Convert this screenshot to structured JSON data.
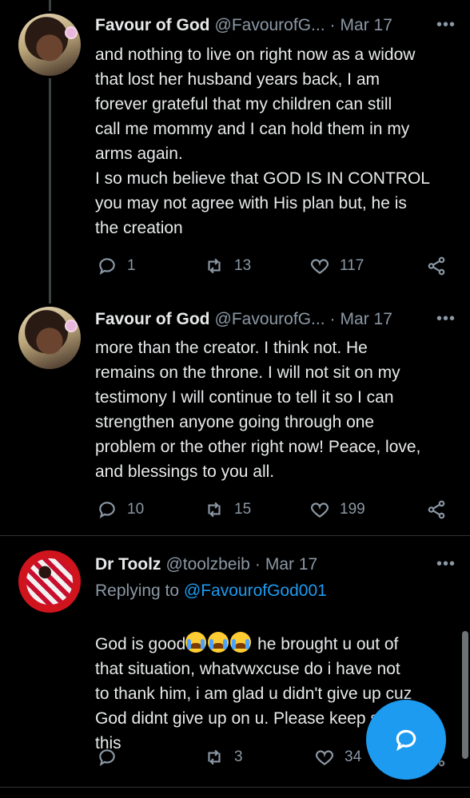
{
  "tweets": [
    {
      "name": "Favour of God",
      "handle": "@FavourofG...",
      "dot": "·",
      "date": "Mar 17",
      "more": "•••",
      "text": "and nothing to live on right now as a widow\nthat lost her husband years back, I am\nforever grateful that my children can still\ncall me mommy and I can hold them in my\narms again.\nI so much believe that GOD IS IN CONTROL\nyou may not agree with His plan but, he is\nthe creation",
      "replies": "1",
      "retweets": "13",
      "likes": "117"
    },
    {
      "name": "Favour of God",
      "handle": "@FavourofG...",
      "dot": "·",
      "date": "Mar 17",
      "more": "•••",
      "text": "more than the creator. I think not. He\nremains on the throne. I will not sit on my\ntestimony I will continue to tell it so I can\nstrengthen anyone going through one\nproblem or the other right now! Peace, love,\nand blessings to you all.",
      "replies": "10",
      "retweets": "15",
      "likes": "199"
    },
    {
      "name": "Dr Toolz",
      "handle": "@toolzbeib",
      "dot": "·",
      "date": "Mar 17",
      "more": "•••",
      "replying_to_label": "Replying to ",
      "replying_to_handle": "@FavourofGod001",
      "text_start": "God is good",
      "emojis": [
        "loudly-crying-face",
        "loudly-crying-face",
        "loudly-crying-face"
      ],
      "text_after_emoji": " he brought u out of",
      "text_rest": "that situation, whatvwxcuse do i have not\nto thank him, i am glad u didn't give up cuz\nGod didnt give up on u. Please keep sharing\nthis",
      "replies": "",
      "retweets": "3",
      "likes": "34"
    }
  ],
  "colors": {
    "background": "#000000",
    "text": "#e7e9ea",
    "secondary": "#8b98a5",
    "accent": "#1d9bf0"
  },
  "fab": {
    "icon": "compose-reply-icon"
  }
}
